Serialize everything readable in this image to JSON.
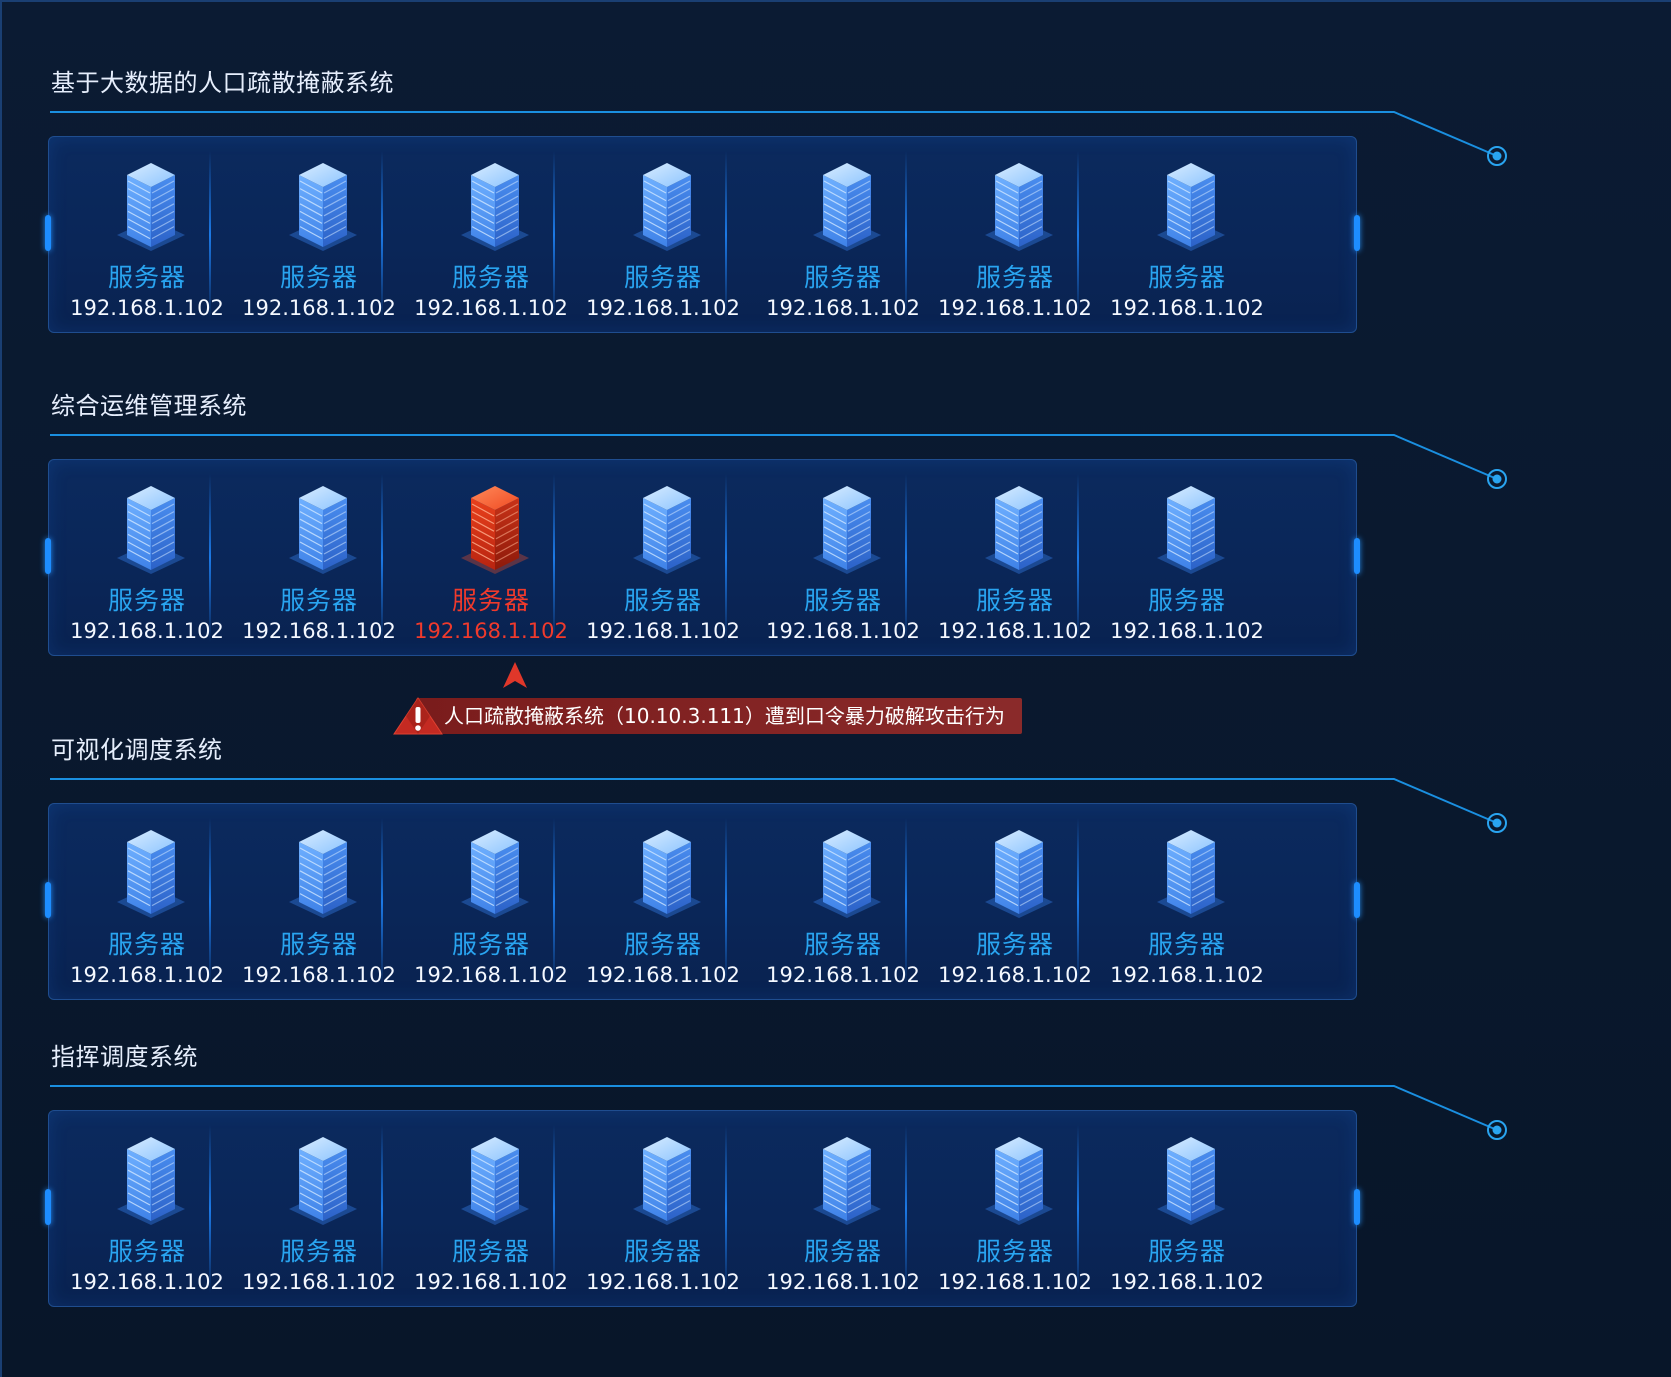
{
  "groups": [
    {
      "title": "基于大数据的人口疏散掩蔽系统",
      "servers": [
        {
          "name": "服务器",
          "ip": "192.168.1.102",
          "status": "normal"
        },
        {
          "name": "服务器",
          "ip": "192.168.1.102",
          "status": "normal"
        },
        {
          "name": "服务器",
          "ip": "192.168.1.102",
          "status": "normal"
        },
        {
          "name": "服务器",
          "ip": "192.168.1.102",
          "status": "normal"
        },
        {
          "name": "服务器",
          "ip": "192.168.1.102",
          "status": "normal"
        },
        {
          "name": "服务器",
          "ip": "192.168.1.102",
          "status": "normal"
        },
        {
          "name": "服务器",
          "ip": "192.168.1.102",
          "status": "normal"
        }
      ]
    },
    {
      "title": "综合运维管理系统",
      "servers": [
        {
          "name": "服务器",
          "ip": "192.168.1.102",
          "status": "normal"
        },
        {
          "name": "服务器",
          "ip": "192.168.1.102",
          "status": "normal"
        },
        {
          "name": "服务器",
          "ip": "192.168.1.102",
          "status": "alert"
        },
        {
          "name": "服务器",
          "ip": "192.168.1.102",
          "status": "normal"
        },
        {
          "name": "服务器",
          "ip": "192.168.1.102",
          "status": "normal"
        },
        {
          "name": "服务器",
          "ip": "192.168.1.102",
          "status": "normal"
        },
        {
          "name": "服务器",
          "ip": "192.168.1.102",
          "status": "normal"
        }
      ]
    },
    {
      "title": "可视化调度系统",
      "servers": [
        {
          "name": "服务器",
          "ip": "192.168.1.102",
          "status": "normal"
        },
        {
          "name": "服务器",
          "ip": "192.168.1.102",
          "status": "normal"
        },
        {
          "name": "服务器",
          "ip": "192.168.1.102",
          "status": "normal"
        },
        {
          "name": "服务器",
          "ip": "192.168.1.102",
          "status": "normal"
        },
        {
          "name": "服务器",
          "ip": "192.168.1.102",
          "status": "normal"
        },
        {
          "name": "服务器",
          "ip": "192.168.1.102",
          "status": "normal"
        },
        {
          "name": "服务器",
          "ip": "192.168.1.102",
          "status": "normal"
        }
      ]
    },
    {
      "title": "指挥调度系统",
      "servers": [
        {
          "name": "服务器",
          "ip": "192.168.1.102",
          "status": "normal"
        },
        {
          "name": "服务器",
          "ip": "192.168.1.102",
          "status": "normal"
        },
        {
          "name": "服务器",
          "ip": "192.168.1.102",
          "status": "normal"
        },
        {
          "name": "服务器",
          "ip": "192.168.1.102",
          "status": "normal"
        },
        {
          "name": "服务器",
          "ip": "192.168.1.102",
          "status": "normal"
        },
        {
          "name": "服务器",
          "ip": "192.168.1.102",
          "status": "normal"
        },
        {
          "name": "服务器",
          "ip": "192.168.1.102",
          "status": "normal"
        }
      ]
    }
  ],
  "alert": {
    "message": "人口疏散掩蔽系统（10.10.3.111）遭到口令暴力破解攻击行为",
    "icon": "warning-icon"
  },
  "colors": {
    "background": "#081629",
    "panel": "#0a2658",
    "accent": "#1d8dff",
    "server_label": "#29a4f0",
    "alert": "#f03a2c",
    "alert_bg": "#7a1c1c"
  }
}
